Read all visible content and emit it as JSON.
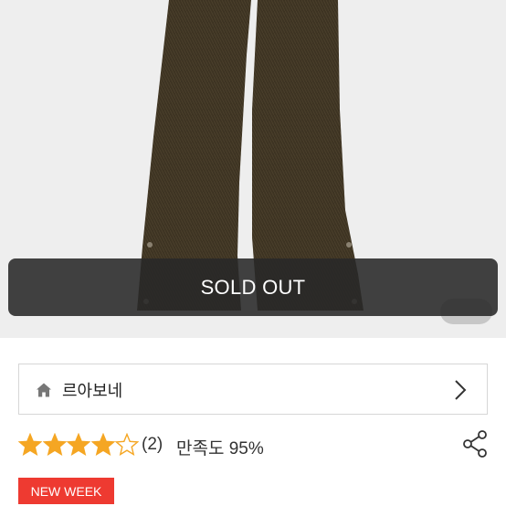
{
  "product": {
    "status_label": "SOLD OUT"
  },
  "brand": {
    "name": "르아보네",
    "icon": "home-icon"
  },
  "rating": {
    "stars_filled": 4,
    "stars_total": 5,
    "review_count": "(2)",
    "satisfaction": "만족도 95%"
  },
  "badge": {
    "label": "NEW WEEK"
  },
  "colors": {
    "star": "#f5a623",
    "badge": "#ee3a31",
    "banner": "#282828"
  }
}
